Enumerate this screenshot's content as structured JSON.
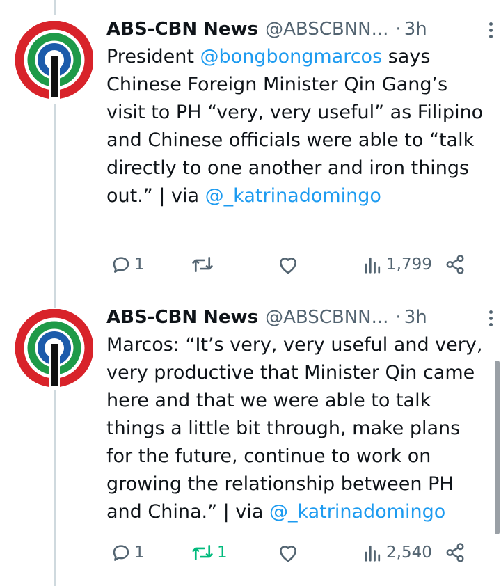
{
  "tweets": [
    {
      "name": "ABS-CBN News",
      "handle": "@ABSCBNN...",
      "dot": "·",
      "time": "3h",
      "text": {
        "t1": "President ",
        "m1": "@bongbongmarcos",
        "t2": " says Chinese Foreign Minister Qin Gang’s visit to PH “very, very useful” as Filipino and Chinese officials were able to “talk directly to one another and iron things out.” | via ",
        "m2": "@_katrinadomingo",
        "t3": ""
      },
      "replies": "1",
      "retweets": "",
      "likes": "",
      "views": "1,799"
    },
    {
      "name": "ABS-CBN News",
      "handle": "@ABSCBNN...",
      "dot": "·",
      "time": "3h",
      "text": {
        "t1": "Marcos: “It’s very, very useful and very, very productive that Minister Qin came here and that we were able to talk things a little bit through, make plans for the future, continue to work on growing the relationship between PH and China.” | via ",
        "m1": "@_katrinadomingo",
        "t2": "",
        "m2": "",
        "t3": ""
      },
      "replies": "1",
      "retweets": "1",
      "likes": "",
      "views": "2,540"
    }
  ],
  "icons": {
    "reply": "reply-icon",
    "retweet": "retweet-icon",
    "like": "heart-icon",
    "views": "views-icon",
    "share": "share-icon",
    "more": "more-icon"
  },
  "colors": {
    "link": "#1d9bf0",
    "retweet_active": "#00ba7c",
    "muted": "#536471",
    "logo_red": "#d8232a",
    "logo_green": "#1f9a48",
    "logo_blue": "#1c5bab"
  }
}
